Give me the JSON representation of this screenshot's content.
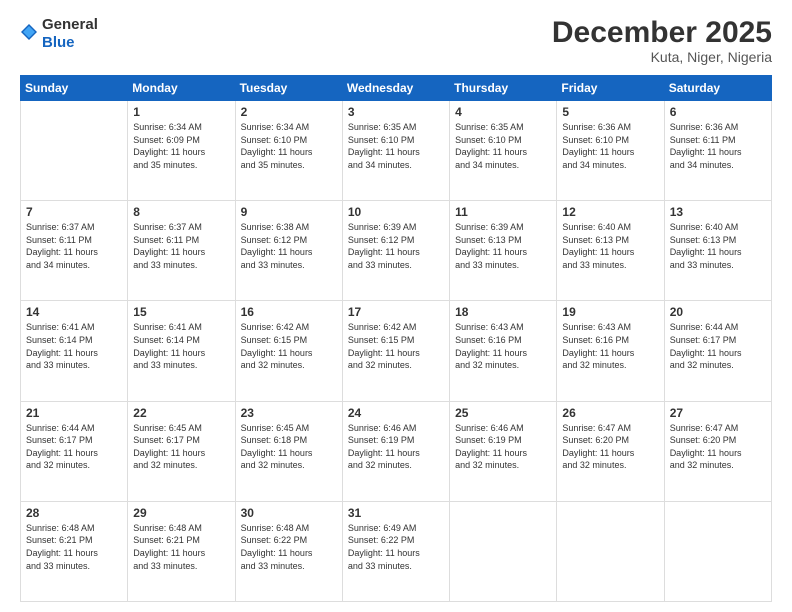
{
  "logo": {
    "general": "General",
    "blue": "Blue"
  },
  "header": {
    "title": "December 2025",
    "subtitle": "Kuta, Niger, Nigeria"
  },
  "weekdays": [
    "Sunday",
    "Monday",
    "Tuesday",
    "Wednesday",
    "Thursday",
    "Friday",
    "Saturday"
  ],
  "weeks": [
    [
      {
        "day": "",
        "sunrise": "",
        "sunset": "",
        "daylight": ""
      },
      {
        "day": "1",
        "sunrise": "Sunrise: 6:34 AM",
        "sunset": "Sunset: 6:09 PM",
        "daylight": "Daylight: 11 hours and 35 minutes."
      },
      {
        "day": "2",
        "sunrise": "Sunrise: 6:34 AM",
        "sunset": "Sunset: 6:10 PM",
        "daylight": "Daylight: 11 hours and 35 minutes."
      },
      {
        "day": "3",
        "sunrise": "Sunrise: 6:35 AM",
        "sunset": "Sunset: 6:10 PM",
        "daylight": "Daylight: 11 hours and 34 minutes."
      },
      {
        "day": "4",
        "sunrise": "Sunrise: 6:35 AM",
        "sunset": "Sunset: 6:10 PM",
        "daylight": "Daylight: 11 hours and 34 minutes."
      },
      {
        "day": "5",
        "sunrise": "Sunrise: 6:36 AM",
        "sunset": "Sunset: 6:10 PM",
        "daylight": "Daylight: 11 hours and 34 minutes."
      },
      {
        "day": "6",
        "sunrise": "Sunrise: 6:36 AM",
        "sunset": "Sunset: 6:11 PM",
        "daylight": "Daylight: 11 hours and 34 minutes."
      }
    ],
    [
      {
        "day": "7",
        "sunrise": "Sunrise: 6:37 AM",
        "sunset": "Sunset: 6:11 PM",
        "daylight": "Daylight: 11 hours and 34 minutes."
      },
      {
        "day": "8",
        "sunrise": "Sunrise: 6:37 AM",
        "sunset": "Sunset: 6:11 PM",
        "daylight": "Daylight: 11 hours and 33 minutes."
      },
      {
        "day": "9",
        "sunrise": "Sunrise: 6:38 AM",
        "sunset": "Sunset: 6:12 PM",
        "daylight": "Daylight: 11 hours and 33 minutes."
      },
      {
        "day": "10",
        "sunrise": "Sunrise: 6:39 AM",
        "sunset": "Sunset: 6:12 PM",
        "daylight": "Daylight: 11 hours and 33 minutes."
      },
      {
        "day": "11",
        "sunrise": "Sunrise: 6:39 AM",
        "sunset": "Sunset: 6:13 PM",
        "daylight": "Daylight: 11 hours and 33 minutes."
      },
      {
        "day": "12",
        "sunrise": "Sunrise: 6:40 AM",
        "sunset": "Sunset: 6:13 PM",
        "daylight": "Daylight: 11 hours and 33 minutes."
      },
      {
        "day": "13",
        "sunrise": "Sunrise: 6:40 AM",
        "sunset": "Sunset: 6:13 PM",
        "daylight": "Daylight: 11 hours and 33 minutes."
      }
    ],
    [
      {
        "day": "14",
        "sunrise": "Sunrise: 6:41 AM",
        "sunset": "Sunset: 6:14 PM",
        "daylight": "Daylight: 11 hours and 33 minutes."
      },
      {
        "day": "15",
        "sunrise": "Sunrise: 6:41 AM",
        "sunset": "Sunset: 6:14 PM",
        "daylight": "Daylight: 11 hours and 33 minutes."
      },
      {
        "day": "16",
        "sunrise": "Sunrise: 6:42 AM",
        "sunset": "Sunset: 6:15 PM",
        "daylight": "Daylight: 11 hours and 32 minutes."
      },
      {
        "day": "17",
        "sunrise": "Sunrise: 6:42 AM",
        "sunset": "Sunset: 6:15 PM",
        "daylight": "Daylight: 11 hours and 32 minutes."
      },
      {
        "day": "18",
        "sunrise": "Sunrise: 6:43 AM",
        "sunset": "Sunset: 6:16 PM",
        "daylight": "Daylight: 11 hours and 32 minutes."
      },
      {
        "day": "19",
        "sunrise": "Sunrise: 6:43 AM",
        "sunset": "Sunset: 6:16 PM",
        "daylight": "Daylight: 11 hours and 32 minutes."
      },
      {
        "day": "20",
        "sunrise": "Sunrise: 6:44 AM",
        "sunset": "Sunset: 6:17 PM",
        "daylight": "Daylight: 11 hours and 32 minutes."
      }
    ],
    [
      {
        "day": "21",
        "sunrise": "Sunrise: 6:44 AM",
        "sunset": "Sunset: 6:17 PM",
        "daylight": "Daylight: 11 hours and 32 minutes."
      },
      {
        "day": "22",
        "sunrise": "Sunrise: 6:45 AM",
        "sunset": "Sunset: 6:17 PM",
        "daylight": "Daylight: 11 hours and 32 minutes."
      },
      {
        "day": "23",
        "sunrise": "Sunrise: 6:45 AM",
        "sunset": "Sunset: 6:18 PM",
        "daylight": "Daylight: 11 hours and 32 minutes."
      },
      {
        "day": "24",
        "sunrise": "Sunrise: 6:46 AM",
        "sunset": "Sunset: 6:19 PM",
        "daylight": "Daylight: 11 hours and 32 minutes."
      },
      {
        "day": "25",
        "sunrise": "Sunrise: 6:46 AM",
        "sunset": "Sunset: 6:19 PM",
        "daylight": "Daylight: 11 hours and 32 minutes."
      },
      {
        "day": "26",
        "sunrise": "Sunrise: 6:47 AM",
        "sunset": "Sunset: 6:20 PM",
        "daylight": "Daylight: 11 hours and 32 minutes."
      },
      {
        "day": "27",
        "sunrise": "Sunrise: 6:47 AM",
        "sunset": "Sunset: 6:20 PM",
        "daylight": "Daylight: 11 hours and 32 minutes."
      }
    ],
    [
      {
        "day": "28",
        "sunrise": "Sunrise: 6:48 AM",
        "sunset": "Sunset: 6:21 PM",
        "daylight": "Daylight: 11 hours and 33 minutes."
      },
      {
        "day": "29",
        "sunrise": "Sunrise: 6:48 AM",
        "sunset": "Sunset: 6:21 PM",
        "daylight": "Daylight: 11 hours and 33 minutes."
      },
      {
        "day": "30",
        "sunrise": "Sunrise: 6:48 AM",
        "sunset": "Sunset: 6:22 PM",
        "daylight": "Daylight: 11 hours and 33 minutes."
      },
      {
        "day": "31",
        "sunrise": "Sunrise: 6:49 AM",
        "sunset": "Sunset: 6:22 PM",
        "daylight": "Daylight: 11 hours and 33 minutes."
      },
      {
        "day": "",
        "sunrise": "",
        "sunset": "",
        "daylight": ""
      },
      {
        "day": "",
        "sunrise": "",
        "sunset": "",
        "daylight": ""
      },
      {
        "day": "",
        "sunrise": "",
        "sunset": "",
        "daylight": ""
      }
    ]
  ]
}
